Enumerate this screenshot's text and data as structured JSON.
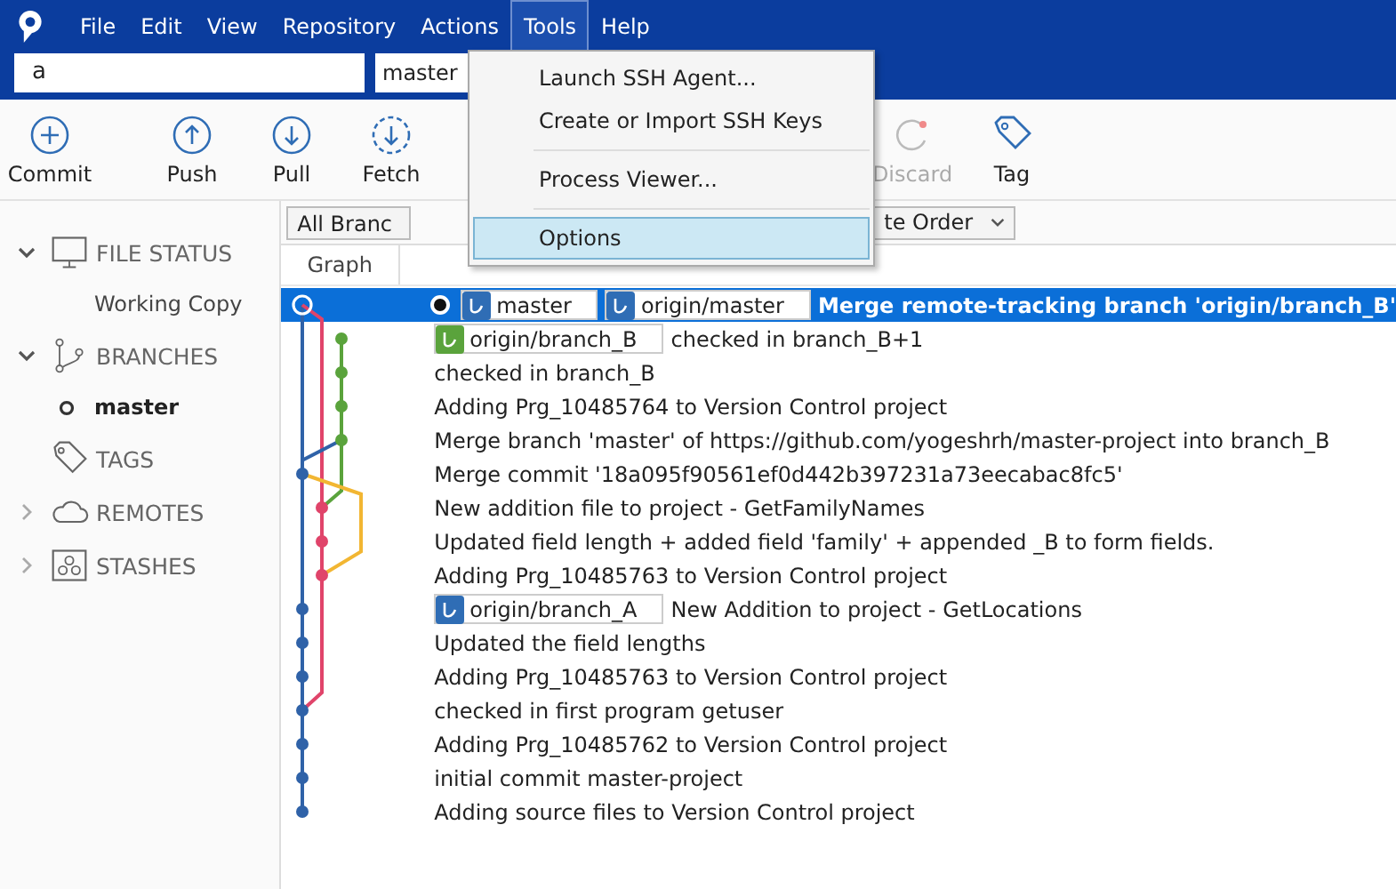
{
  "menu_bar": [
    {
      "label": "File",
      "selected": false
    },
    {
      "label": "Edit",
      "selected": false
    },
    {
      "label": "View",
      "selected": false
    },
    {
      "label": "Repository",
      "selected": false
    },
    {
      "label": "Actions",
      "selected": false
    },
    {
      "label": "Tools",
      "selected": true
    },
    {
      "label": "Help",
      "selected": false
    }
  ],
  "search_field": {
    "value": "a"
  },
  "branch_field": {
    "value": "master"
  },
  "toolbar": [
    {
      "kind": "commit",
      "label": "Commit",
      "disabled": false
    },
    {
      "kind": "push",
      "label": "Push",
      "disabled": false
    },
    {
      "kind": "pull",
      "label": "Pull",
      "disabled": false
    },
    {
      "kind": "fetch",
      "label": "Fetch",
      "disabled": false
    },
    {
      "kind": "discard",
      "label": "Discard",
      "disabled": true
    },
    {
      "kind": "tag",
      "label": "Tag",
      "disabled": false
    }
  ],
  "sidebar": [
    {
      "kind": "file-status",
      "label": "FILE STATUS",
      "expanded": true,
      "children": [
        {
          "label": "Working Copy",
          "current": false
        }
      ]
    },
    {
      "kind": "branches",
      "label": "BRANCHES",
      "expanded": true,
      "children": [
        {
          "label": "master",
          "current": true
        }
      ]
    },
    {
      "kind": "tags",
      "label": "TAGS"
    },
    {
      "kind": "remotes",
      "label": "REMOTES",
      "expanded": false
    },
    {
      "kind": "stashes",
      "label": "STASHES",
      "expanded": false
    }
  ],
  "filters": [
    {
      "value": "All Branc"
    },
    {
      "value": "te Order"
    }
  ],
  "table": {
    "columns": [
      "Graph"
    ],
    "rows": [
      {
        "message": "Merge remote-tracking branch 'origin/branch_B'",
        "selected": true,
        "current": true,
        "refs": [
          {
            "name": "master",
            "color": "#2f6db5"
          },
          {
            "name": "origin/master",
            "color": "#2f6db5"
          }
        ]
      },
      {
        "message": "checked in branch_B+1",
        "selected": false,
        "current": false,
        "refs": [
          {
            "name": "origin/branch_B",
            "color": "#5aa33c"
          }
        ]
      },
      {
        "message": "checked in branch_B",
        "selected": false,
        "current": false,
        "refs": []
      },
      {
        "message": "Adding Prg_10485764 to Version Control project",
        "selected": false,
        "current": false,
        "refs": []
      },
      {
        "message": "Merge branch 'master' of https://github.com/yogeshrh/master-project into branch_B",
        "selected": false,
        "current": false,
        "refs": []
      },
      {
        "message": "Merge commit '18a095f90561ef0d442b397231a73eecabac8fc5'",
        "selected": false,
        "current": false,
        "refs": []
      },
      {
        "message": "New addition file to project - GetFamilyNames",
        "selected": false,
        "current": false,
        "refs": []
      },
      {
        "message": "Updated field length + added field 'family' + appended _B to form fields.",
        "selected": false,
        "current": false,
        "refs": []
      },
      {
        "message": "Adding Prg_10485763 to Version Control project",
        "selected": false,
        "current": false,
        "refs": []
      },
      {
        "message": "New Addition to project - GetLocations",
        "selected": false,
        "current": false,
        "refs": [
          {
            "name": "origin/branch_A",
            "color": "#2f6db5"
          }
        ]
      },
      {
        "message": "Updated the field lengths",
        "selected": false,
        "current": false,
        "refs": []
      },
      {
        "message": "Adding Prg_10485763 to Version Control project",
        "selected": false,
        "current": false,
        "refs": []
      },
      {
        "message": "checked in first program getuser",
        "selected": false,
        "current": false,
        "refs": []
      },
      {
        "message": "Adding Prg_10485762 to Version Control project",
        "selected": false,
        "current": false,
        "refs": []
      },
      {
        "message": "initial commit master-project",
        "selected": false,
        "current": false,
        "refs": []
      },
      {
        "message": "Adding source files to Version Control project",
        "selected": false,
        "current": false,
        "refs": []
      }
    ]
  },
  "dropdown_menu": [
    {
      "kind": "item",
      "label": "Launch SSH Agent...",
      "selected": false
    },
    {
      "kind": "item",
      "label": "Create or Import SSH Keys",
      "selected": false
    },
    {
      "kind": "separator"
    },
    {
      "kind": "item",
      "label": "Process Viewer...",
      "selected": false
    },
    {
      "kind": "separator"
    },
    {
      "kind": "item",
      "label": "Options",
      "selected": true
    }
  ]
}
